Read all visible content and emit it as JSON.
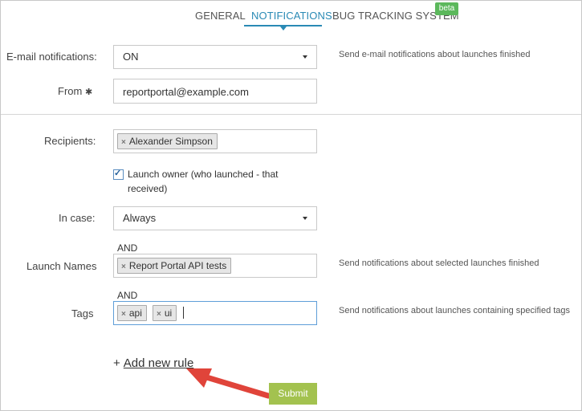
{
  "tabs": [
    {
      "label": "GENERAL"
    },
    {
      "label": "NOTIFICATIONS"
    },
    {
      "label": "BUG TRACKING SYSTEM"
    }
  ],
  "beta_badge": "beta",
  "form": {
    "email_notifications": {
      "label": "E-mail notifications:",
      "value": "ON",
      "hint": "Send e-mail notifications about launches finished"
    },
    "from": {
      "label": "From",
      "required_mark": "✱",
      "value": "reportportal@example.com"
    },
    "recipients": {
      "label": "Recipients:",
      "tags": [
        "Alexander Simpson"
      ]
    },
    "launch_owner": {
      "checked": true,
      "label": "Launch owner (who launched - that received)"
    },
    "in_case": {
      "label": "In case:",
      "value": "Always"
    },
    "launch_names": {
      "and_label": "AND",
      "label": "Launch Names",
      "tags": [
        "Report Portal API tests"
      ],
      "hint": "Send notifications about selected launches finished"
    },
    "tags_field": {
      "and_label": "AND",
      "label": "Tags",
      "tags": [
        "api",
        "ui"
      ],
      "hint": "Send notifications about launches containing specified tags"
    }
  },
  "add_rule": {
    "plus": "+",
    "label": "Add new rule"
  },
  "submit_label": "Submit",
  "colors": {
    "accent": "#2a8ab5",
    "beta": "#5cb85c",
    "submit": "#a3c24f",
    "annotation_arrow": "#e0443a"
  },
  "tag_remove_glyph": "×",
  "check_glyph": "✓"
}
